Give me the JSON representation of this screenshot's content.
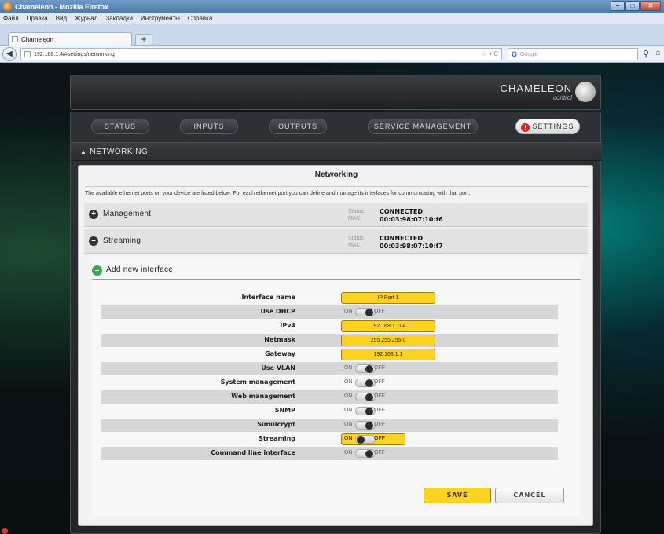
{
  "browser": {
    "window_title": "Chameleon - Mozilla Firefox",
    "menu": [
      "Файл",
      "Правка",
      "Вид",
      "Журнал",
      "Закладки",
      "Инструменты",
      "Справка"
    ],
    "tab_title": "Chameleon",
    "new_tab": "+",
    "url": "192.168.1.4/#settings/networking",
    "search_placeholder": "Google",
    "search_engine": "G"
  },
  "app": {
    "logo": "CHAMELEON",
    "logo_sub": "control",
    "nav": [
      {
        "label": "STATUS"
      },
      {
        "label": "INPUTS"
      },
      {
        "label": "OUTPUTS"
      },
      {
        "label": "SERVICE MANAGEMENT"
      },
      {
        "label": "SETTINGS",
        "active": true
      }
    ],
    "section": "NETWORKING"
  },
  "networking": {
    "title": "Networking",
    "description": "The available ethernet ports on your device are listed below. For each ethernet port you can define and manage its interfaces for communicating with that port.",
    "ports": [
      {
        "name": "Management",
        "status_label": "Status",
        "status": "CONNECTED",
        "mac_label": "MAC",
        "mac": "00:03:98:07:10:f6",
        "expanded": false
      },
      {
        "name": "Streaming",
        "status_label": "Status",
        "status": "CONNECTED",
        "mac_label": "MAC",
        "mac": "00:03:98:07:10:f7",
        "expanded": true
      }
    ],
    "add_interface": "Add new interface",
    "form": {
      "interface_name": {
        "label": "Interface name",
        "value": "IP Port 1"
      },
      "use_dhcp": {
        "label": "Use DHCP",
        "on": "ON",
        "off": "OFF",
        "enabled": false
      },
      "ipv4": {
        "label": "IPv4",
        "value": "192.168.1.104"
      },
      "netmask": {
        "label": "Netmask",
        "value": "255.255.255.0"
      },
      "gateway": {
        "label": "Gateway",
        "value": "192.168.1.1"
      },
      "use_vlan": {
        "label": "Use VLAN",
        "on": "ON",
        "off": "OFF",
        "enabled": false
      },
      "system_management": {
        "label": "System management",
        "on": "ON",
        "off": "OFF",
        "enabled": false
      },
      "web_management": {
        "label": "Web management",
        "on": "ON",
        "off": "OFF",
        "enabled": false
      },
      "snmp": {
        "label": "SNMP",
        "on": "ON",
        "off": "OFF",
        "enabled": false
      },
      "simulcrypt": {
        "label": "Simulcrypt",
        "on": "ON",
        "off": "OFF",
        "enabled": false
      },
      "streaming": {
        "label": "Streaming",
        "on": "ON",
        "off": "OFF",
        "enabled": true
      },
      "cli": {
        "label": "Command line interface",
        "on": "ON",
        "off": "OFF",
        "enabled": false
      }
    },
    "save": "SAVE",
    "cancel": "CANCEL"
  },
  "colors": {
    "accent_yellow": "#fed220",
    "settings_red": "#d9231b",
    "add_green": "#3ba84f"
  }
}
